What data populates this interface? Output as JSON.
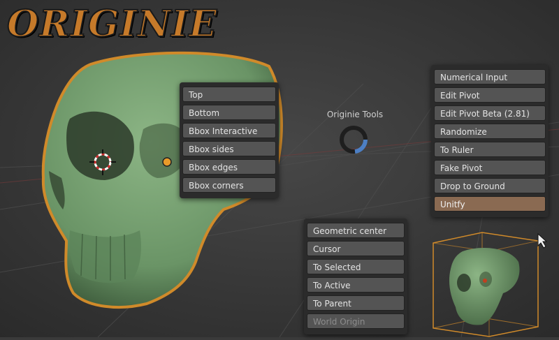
{
  "logo": {
    "text": "ORIGINIE"
  },
  "pie_menu": {
    "title": "Originie Tools",
    "left_column": [
      {
        "label": "Top"
      },
      {
        "label": "Bottom"
      },
      {
        "label": "Bbox Interactive"
      },
      {
        "label": "Bbox sides"
      },
      {
        "label": "Bbox edges"
      },
      {
        "label": "Bbox corners"
      }
    ],
    "right_column": [
      {
        "label": "Numerical Input"
      },
      {
        "label": "Edit Pivot"
      },
      {
        "label": "Edit Pivot Beta (2.81)"
      },
      {
        "label": "Randomize"
      },
      {
        "label": "To Ruler"
      },
      {
        "label": "Fake Pivot"
      },
      {
        "label": "Drop to Ground"
      },
      {
        "label": "Unitfy"
      }
    ],
    "bottom_column": [
      {
        "label": "Geometric center"
      },
      {
        "label": "Cursor"
      },
      {
        "label": "To Selected"
      },
      {
        "label": "To Active"
      },
      {
        "label": "To Parent"
      },
      {
        "label": "World Origin"
      }
    ]
  },
  "colors": {
    "background": "#3a3a3a",
    "skull": "#6f9a6a",
    "selection_outline": "#d08a2a",
    "accent_active": "#8a6a52"
  }
}
